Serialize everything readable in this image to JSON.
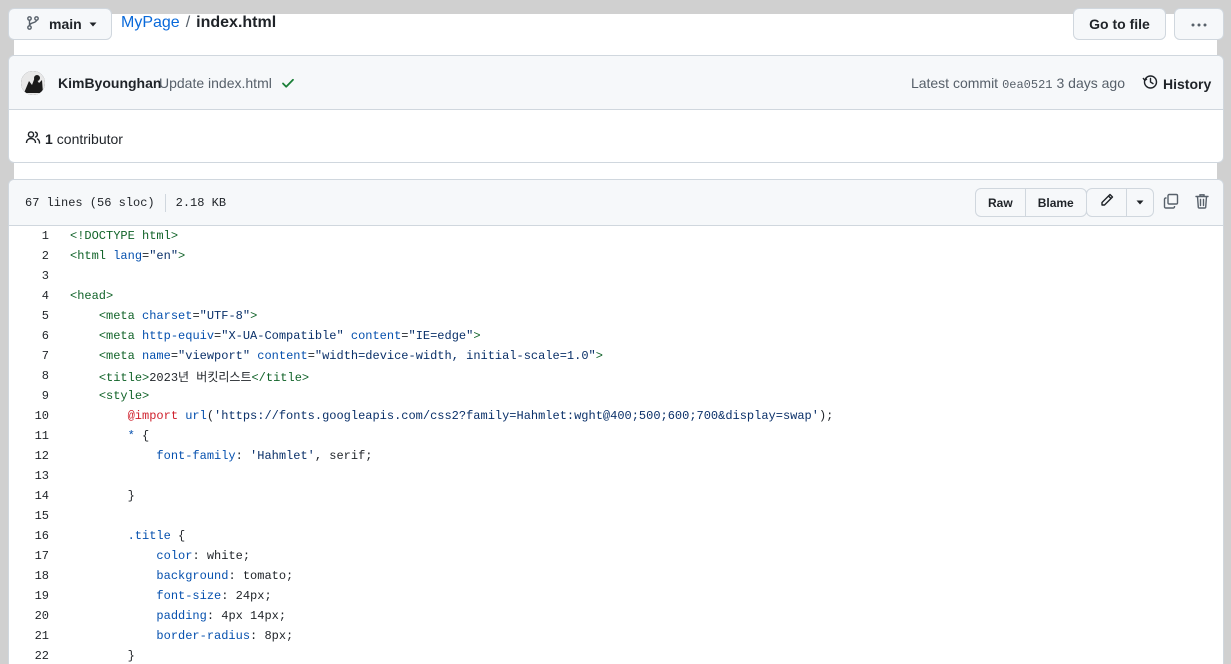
{
  "branch": {
    "name": "main"
  },
  "breadcrumb": {
    "repo": "MyPage",
    "separator": "/",
    "file": "index.html"
  },
  "toolbar": {
    "goto_file": "Go to file"
  },
  "commit": {
    "author": "KimByounghan",
    "message": "Update index.html",
    "latest_label": "Latest commit",
    "sha": "0ea0521",
    "time": "3 days ago",
    "history_label": "History"
  },
  "contributors": {
    "count": "1",
    "label": "contributor"
  },
  "file": {
    "lines_info": "67 lines (56 sloc)",
    "size": "2.18 KB",
    "raw_label": "Raw",
    "blame_label": "Blame"
  },
  "code_lines": [
    {
      "n": "1",
      "segs": [
        [
          "t",
          "<!DOCTYPE html>"
        ]
      ]
    },
    {
      "n": "2",
      "segs": [
        [
          "t",
          "<html "
        ],
        [
          "a",
          "lang"
        ],
        [
          "",
          "="
        ],
        [
          "s",
          "\"en\""
        ],
        [
          "t",
          ">"
        ]
      ]
    },
    {
      "n": "3",
      "segs": []
    },
    {
      "n": "4",
      "segs": [
        [
          "t",
          "<head>"
        ]
      ]
    },
    {
      "n": "5",
      "segs": [
        [
          "",
          "    "
        ],
        [
          "t",
          "<meta "
        ],
        [
          "a",
          "charset"
        ],
        [
          "",
          "="
        ],
        [
          "s",
          "\"UTF-8\""
        ],
        [
          "t",
          ">"
        ]
      ]
    },
    {
      "n": "6",
      "segs": [
        [
          "",
          "    "
        ],
        [
          "t",
          "<meta "
        ],
        [
          "a",
          "http-equiv"
        ],
        [
          "",
          "="
        ],
        [
          "s",
          "\"X-UA-Compatible\""
        ],
        [
          "",
          " "
        ],
        [
          "a",
          "content"
        ],
        [
          "",
          "="
        ],
        [
          "s",
          "\"IE=edge\""
        ],
        [
          "t",
          ">"
        ]
      ]
    },
    {
      "n": "7",
      "segs": [
        [
          "",
          "    "
        ],
        [
          "t",
          "<meta "
        ],
        [
          "a",
          "name"
        ],
        [
          "",
          "="
        ],
        [
          "s",
          "\"viewport\""
        ],
        [
          "",
          " "
        ],
        [
          "a",
          "content"
        ],
        [
          "",
          "="
        ],
        [
          "s",
          "\"width=device-width, initial-scale=1.0\""
        ],
        [
          "t",
          ">"
        ]
      ]
    },
    {
      "n": "8",
      "segs": [
        [
          "",
          "    "
        ],
        [
          "t",
          "<title>"
        ],
        [
          "",
          "2023년 버킷리스트"
        ],
        [
          "t",
          "</title>"
        ]
      ]
    },
    {
      "n": "9",
      "segs": [
        [
          "",
          "    "
        ],
        [
          "t",
          "<style>"
        ]
      ]
    },
    {
      "n": "10",
      "segs": [
        [
          "",
          "        "
        ],
        [
          "k",
          "@import"
        ],
        [
          "",
          " "
        ],
        [
          "p",
          "url"
        ],
        [
          "",
          "("
        ],
        [
          "s",
          "'https://fonts.googleapis.com/css2?family=Hahmlet:wght@400;500;600;700&display=swap'"
        ],
        [
          "",
          ");"
        ]
      ]
    },
    {
      "n": "11",
      "segs": [
        [
          "",
          "        "
        ],
        [
          "a",
          "*"
        ],
        [
          "",
          " {"
        ]
      ]
    },
    {
      "n": "12",
      "segs": [
        [
          "",
          "            "
        ],
        [
          "p",
          "font-family"
        ],
        [
          "",
          ": "
        ],
        [
          "s",
          "'Hahmlet'"
        ],
        [
          "",
          ", serif;"
        ]
      ]
    },
    {
      "n": "13",
      "segs": []
    },
    {
      "n": "14",
      "segs": [
        [
          "",
          "        }"
        ]
      ]
    },
    {
      "n": "15",
      "segs": []
    },
    {
      "n": "16",
      "segs": [
        [
          "",
          "        "
        ],
        [
          "a",
          ".title"
        ],
        [
          "",
          " {"
        ]
      ]
    },
    {
      "n": "17",
      "segs": [
        [
          "",
          "            "
        ],
        [
          "p",
          "color"
        ],
        [
          "",
          ": white;"
        ]
      ]
    },
    {
      "n": "18",
      "segs": [
        [
          "",
          "            "
        ],
        [
          "p",
          "background"
        ],
        [
          "",
          ": tomato;"
        ]
      ]
    },
    {
      "n": "19",
      "segs": [
        [
          "",
          "            "
        ],
        [
          "p",
          "font-size"
        ],
        [
          "",
          ": 24px;"
        ]
      ]
    },
    {
      "n": "20",
      "segs": [
        [
          "",
          "            "
        ],
        [
          "p",
          "padding"
        ],
        [
          "",
          ": 4px 14px;"
        ]
      ]
    },
    {
      "n": "21",
      "segs": [
        [
          "",
          "            "
        ],
        [
          "p",
          "border-radius"
        ],
        [
          "",
          ": 8px;"
        ]
      ]
    },
    {
      "n": "22",
      "segs": [
        [
          "",
          "        }"
        ]
      ]
    }
  ]
}
